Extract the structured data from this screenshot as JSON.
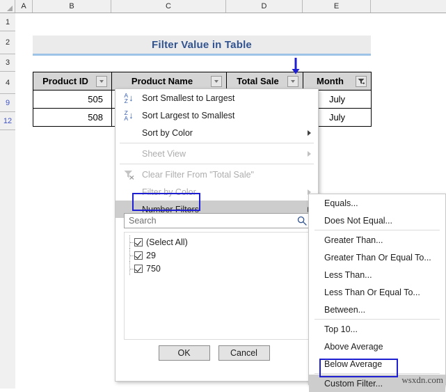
{
  "sheet": {
    "column_headers": [
      "A",
      "B",
      "C",
      "D",
      "E"
    ],
    "row_headers": [
      {
        "label": "1",
        "filtered": false
      },
      {
        "label": "2",
        "filtered": false
      },
      {
        "label": "3",
        "filtered": false
      },
      {
        "label": "4",
        "filtered": false
      },
      {
        "label": "9",
        "filtered": true
      },
      {
        "label": "12",
        "filtered": true
      }
    ]
  },
  "title_banner": {
    "text": "Filter Value in Table",
    "text_color": "#31538f",
    "background": "#ebebeb",
    "underline_color": "#9dc3e6"
  },
  "table": {
    "headers": [
      {
        "label": "Product ID",
        "filter_state": "open"
      },
      {
        "label": "Product Name",
        "filter_state": "none"
      },
      {
        "label": "Total Sale",
        "filter_state": "none"
      },
      {
        "label": "Month",
        "filter_state": "applied"
      }
    ],
    "rows": [
      [
        "505",
        "",
        "",
        "July"
      ],
      [
        "508",
        "",
        "",
        "July"
      ]
    ]
  },
  "annotation": {
    "arrow_color": "#1f1fd2",
    "highlight_color": "#1f1fd2",
    "highlighted_items": [
      "Number Filters",
      "Custom Filter..."
    ]
  },
  "filter_menu": {
    "items": [
      {
        "label": "Sort Smallest to Largest",
        "icon": "sort-az-icon",
        "disabled": false,
        "submenu": false,
        "highlighted": false
      },
      {
        "label": "Sort Largest to Smallest",
        "icon": "sort-za-icon",
        "disabled": false,
        "submenu": false,
        "highlighted": false
      },
      {
        "label": "Sort by Color",
        "icon": "",
        "disabled": false,
        "submenu": true,
        "highlighted": false
      },
      {
        "label": "Sheet View",
        "icon": "",
        "disabled": true,
        "submenu": true,
        "highlighted": false
      },
      {
        "label": "Clear Filter From \"Total Sale\"",
        "icon": "clear-filter-icon",
        "disabled": true,
        "submenu": false,
        "highlighted": false
      },
      {
        "label": "Filter by Color",
        "icon": "",
        "disabled": true,
        "submenu": true,
        "highlighted": false
      },
      {
        "label": "Number Filters",
        "icon": "",
        "disabled": false,
        "submenu": true,
        "highlighted": true
      }
    ],
    "search": {
      "placeholder": "Search",
      "value": "",
      "icon": "search-icon"
    },
    "value_list": [
      {
        "label": "(Select All)",
        "checked": true
      },
      {
        "label": "29",
        "checked": true
      },
      {
        "label": "750",
        "checked": true
      }
    ],
    "ok_label": "OK",
    "cancel_label": "Cancel"
  },
  "number_filters_submenu": {
    "items": [
      {
        "label": "Equals...",
        "accel": "E",
        "highlighted": false
      },
      {
        "label": "Does Not Equal...",
        "accel": "N",
        "highlighted": false
      },
      {
        "sep": true
      },
      {
        "label": "Greater Than...",
        "accel": "G",
        "highlighted": false
      },
      {
        "label": "Greater Than Or Equal To...",
        "accel": "O",
        "highlighted": false
      },
      {
        "label": "Less Than...",
        "accel": "L",
        "highlighted": false
      },
      {
        "label": "Less Than Or Equal To...",
        "accel": "Q",
        "highlighted": false
      },
      {
        "label": "Between...",
        "accel": "w",
        "highlighted": false
      },
      {
        "sep": true
      },
      {
        "label": "Top 10...",
        "accel": "T",
        "highlighted": false
      },
      {
        "label": "Above Average",
        "accel": "A",
        "highlighted": false
      },
      {
        "label": "Below Average",
        "accel": "o",
        "highlighted": false
      },
      {
        "sep": true
      },
      {
        "label": "Custom Filter...",
        "accel": "F",
        "highlighted": true
      }
    ]
  },
  "watermark": {
    "text": "wsxdn.com"
  }
}
